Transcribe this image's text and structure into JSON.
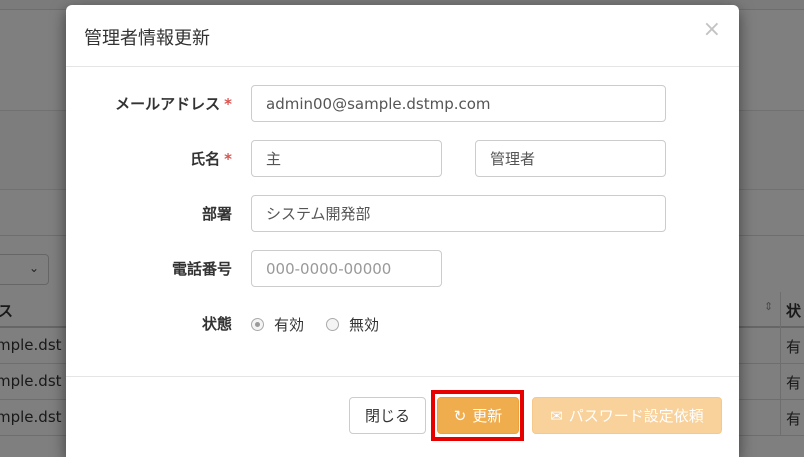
{
  "modal": {
    "title": "管理者情報更新",
    "close_icon": "×"
  },
  "form": {
    "email": {
      "label": "メールアドレス",
      "required_mark": "*",
      "value": "admin00@sample.dstmp.com"
    },
    "name": {
      "label": "氏名",
      "required_mark": "*",
      "last_value": "主",
      "first_value": "管理者"
    },
    "department": {
      "label": "部署",
      "value": "システム開発部"
    },
    "phone": {
      "label": "電話番号",
      "placeholder": "000-0000-00000"
    },
    "status": {
      "label": "状態",
      "options": [
        {
          "label": "有効",
          "checked": true
        },
        {
          "label": "無効",
          "checked": false
        }
      ]
    }
  },
  "footer": {
    "close_label": "閉じる",
    "update_icon": "↻",
    "update_label": "更新",
    "reset_icon": "✉",
    "reset_label": "パスワード設定依頼"
  },
  "background": {
    "table_header_left": "ス",
    "table_header_right": "状",
    "rows": [
      {
        "left": "mple.dst",
        "right": "有"
      },
      {
        "left": "mple.dst",
        "right": "有"
      },
      {
        "left": "mple.dst",
        "right": "有"
      }
    ],
    "select_chevron": "⌄",
    "sort_icon": "⇕"
  }
}
